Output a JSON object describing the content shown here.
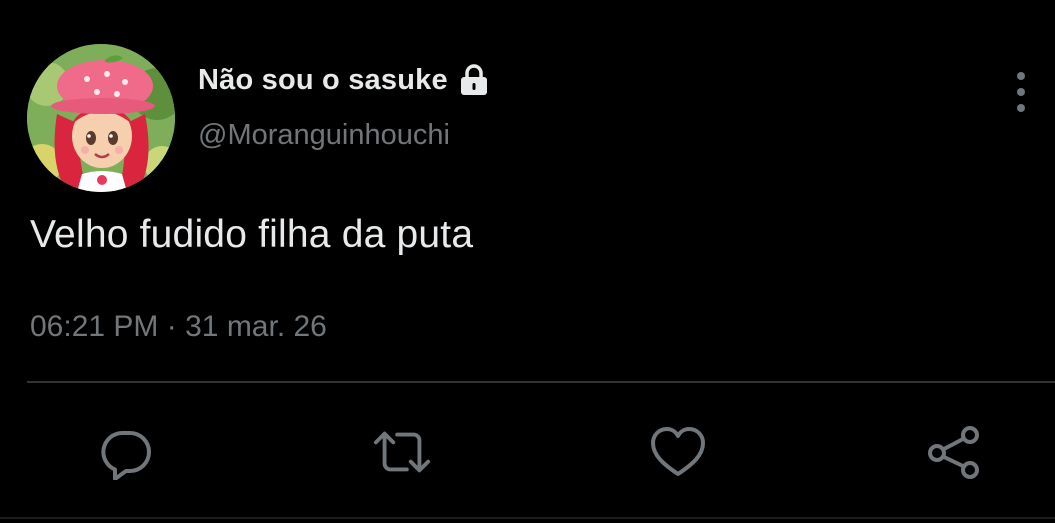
{
  "user": {
    "display_name": "Não sou o sasuke",
    "handle": "@Moranguinhouchi",
    "avatar_icon": "strawberry-character-avatar",
    "protected_icon": "lock-icon"
  },
  "tweet": {
    "text": "Velho fudido filha da puta",
    "time": "06:21 PM",
    "separator": "·",
    "date": "31 mar. 26"
  },
  "actions": {
    "reply_icon": "reply-icon",
    "retweet_icon": "retweet-icon",
    "like_icon": "heart-icon",
    "share_icon": "share-icon"
  },
  "colors": {
    "background": "#000000",
    "primary_text": "#e7e9ea",
    "secondary_text": "#71767b",
    "divider": "#2f3336"
  }
}
